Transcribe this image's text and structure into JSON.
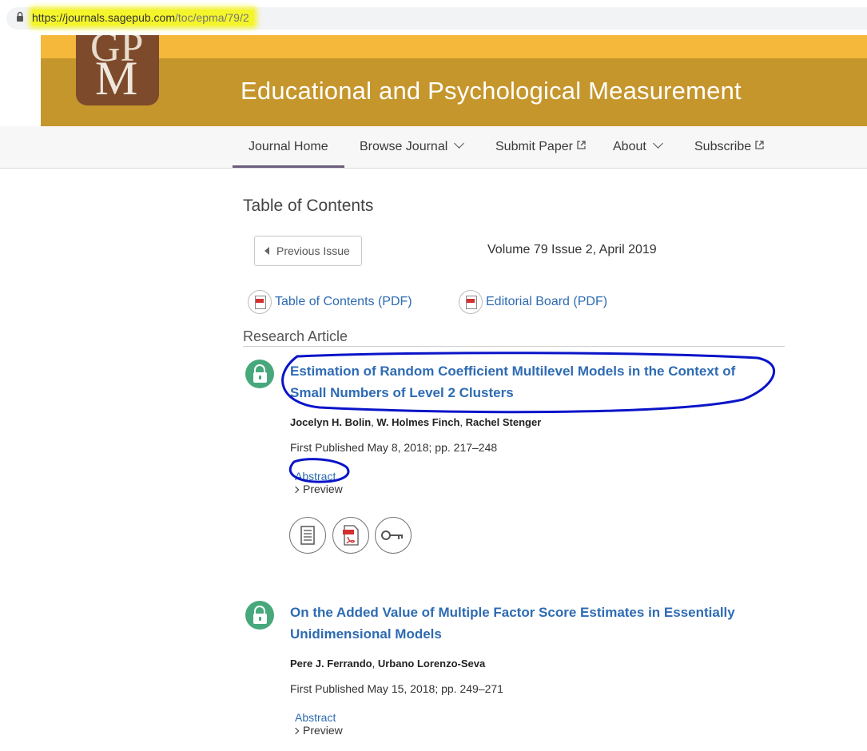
{
  "browser": {
    "url_host": "https://journals.sagepub.com",
    "url_path": "/toc/epma/79/2"
  },
  "banner": {
    "title": "Educational and Psychological Measurement",
    "logo_letters_top": "GP",
    "logo_letters_bottom": "M"
  },
  "nav": {
    "items": [
      {
        "label": "Journal Home",
        "active": true
      },
      {
        "label": "Browse Journal",
        "dropdown": true
      },
      {
        "label": "Submit Paper",
        "external": true
      },
      {
        "label": "About",
        "dropdown": true
      },
      {
        "label": "Subscribe",
        "external": true
      }
    ]
  },
  "toc": {
    "heading": "Table of Contents",
    "prev_issue": "Previous Issue",
    "issue_info": "Volume 79 Issue 2, April 2019",
    "toc_pdf": "Table of Contents (PDF)",
    "board_pdf": "Editorial Board (PDF)",
    "section": "Research Article"
  },
  "articles": [
    {
      "title_line1": "Estimation of Random Coefficient Multilevel Models in the Context of",
      "title_line2": "Small Numbers of Level 2 Clusters",
      "authors": [
        "Jocelyn H. Bolin",
        "W. Holmes Finch",
        "Rachel Stenger"
      ],
      "published": "First Published May 8, 2018; pp. 217–248",
      "abstract": "Abstract",
      "preview": "Preview"
    },
    {
      "title_line1": "On the Added Value of Multiple Factor Score Estimates in Essentially",
      "title_line2": "Unidimensional Models",
      "authors": [
        "Pere J. Ferrando",
        "Urbano Lorenzo-Seva"
      ],
      "published": "First Published May 15, 2018; pp. 249–271",
      "abstract": "Abstract",
      "preview": "Preview"
    }
  ],
  "annotation_color": "#0a14c8",
  "highlight_color": "#f4f52a"
}
